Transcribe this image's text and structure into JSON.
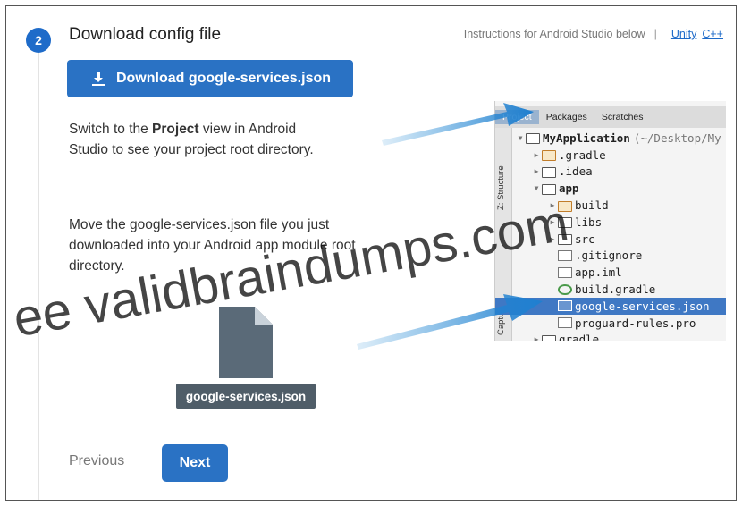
{
  "step": {
    "number": "2",
    "title": "Download config file"
  },
  "instructions": {
    "text": "Instructions for Android Studio below",
    "separator": "|",
    "link_unity": "Unity",
    "link_cpp": "C++"
  },
  "download_button": {
    "label": "Download google-services.json",
    "icon": "download-icon"
  },
  "para1": {
    "before": "Switch to the ",
    "bold": "Project",
    "after": " view in Android Studio to see your project root directory."
  },
  "para2": {
    "text": "Move the google-services.json file you just downloaded into your Android app module root directory."
  },
  "file": {
    "label": "google-services.json",
    "icon": "document-icon"
  },
  "nav": {
    "previous": "Previous",
    "next": "Next"
  },
  "android_studio": {
    "tabs": [
      "Project",
      "Packages",
      "Scratches"
    ],
    "side_labels": [
      "Z: Structure",
      "Captures"
    ],
    "tree": [
      {
        "name": "MyApplication",
        "suffix": "(~/Desktop/My",
        "type": "folder",
        "indent": 0,
        "bold": true
      },
      {
        "name": ".gradle",
        "type": "folder-orange",
        "indent": 1
      },
      {
        "name": ".idea",
        "type": "folder",
        "indent": 1
      },
      {
        "name": "app",
        "type": "folder",
        "indent": 1,
        "bold": true,
        "expanded": true
      },
      {
        "name": "build",
        "type": "folder-orange",
        "indent": 2
      },
      {
        "name": "libs",
        "type": "folder",
        "indent": 2
      },
      {
        "name": "src",
        "type": "folder",
        "indent": 2
      },
      {
        "name": ".gitignore",
        "type": "file",
        "indent": 2
      },
      {
        "name": "app.iml",
        "type": "file",
        "indent": 2
      },
      {
        "name": "build.gradle",
        "type": "gradle",
        "indent": 2
      },
      {
        "name": "google-services.json",
        "type": "file",
        "indent": 2,
        "selected": true
      },
      {
        "name": "proguard-rules.pro",
        "type": "file",
        "indent": 2
      },
      {
        "name": "gradle",
        "type": "folder",
        "indent": 1
      }
    ]
  },
  "watermark": {
    "text": "ee validbraindumps.com"
  },
  "colors": {
    "accent": "#2a72c4",
    "selection": "#3f78c4",
    "file_label_bg": "#4f5d68"
  }
}
